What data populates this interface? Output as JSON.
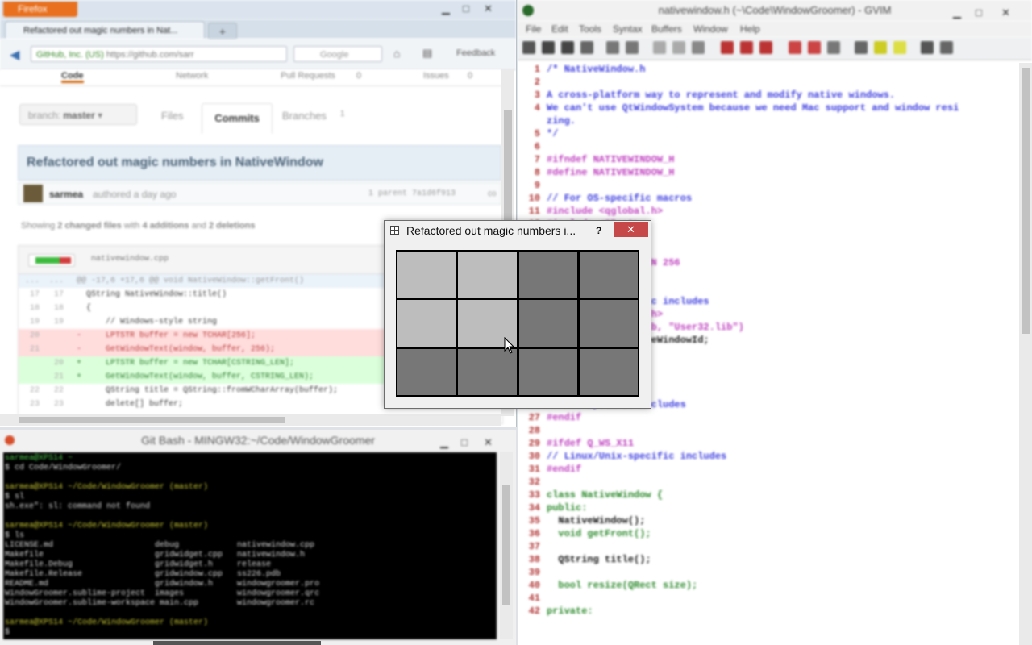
{
  "firefox": {
    "menu_button": "Firefox",
    "tab_title": "Refactored out magic numbers in Nat...",
    "url_identity": "GitHub, Inc. (US)",
    "url": "https://github.com/sarr",
    "search_placeholder": "Google",
    "feedback_label": "Feedback",
    "gh_tabs": [
      "Code",
      "Network",
      "Pull Requests",
      "Issues"
    ],
    "gh_tab_counts": [
      "0",
      "0"
    ],
    "branch_label": "branch:",
    "branch_value": "master",
    "subtabs": [
      "Files",
      "Commits",
      "Branches"
    ],
    "branches_count": "1",
    "commit_title": "Refactored out magic numbers in NativeWindow",
    "author": "sarmea",
    "authored": "authored a day ago",
    "parent_info": "1 parent 7a1d6f913",
    "commit_id": "co",
    "stats_prefix": "Showing",
    "stats_files": "2 changed files",
    "stats_with": "with",
    "stats_add": "4 additions",
    "stats_and": "and",
    "stats_del": "2 deletions",
    "file_name": "nativewindow.cpp",
    "diff_rows": [
      {
        "l1": "...",
        "l2": "...",
        "code": "@@ -17,6 +17,6 @@ void NativeWindow::getFront()",
        "type": "hunk"
      },
      {
        "l1": "17",
        "l2": "17",
        "code": "  QString NativeWindow::title()",
        "type": "ctx"
      },
      {
        "l1": "18",
        "l2": "18",
        "code": "  {",
        "type": "ctx"
      },
      {
        "l1": "19",
        "l2": "19",
        "code": "      // Windows-style string",
        "type": "ctx"
      },
      {
        "l1": "20",
        "l2": "",
        "code": "-     LPTSTR buffer = new TCHAR[256];",
        "type": "del"
      },
      {
        "l1": "21",
        "l2": "",
        "code": "-     GetWindowText(window, buffer, 256);",
        "type": "del"
      },
      {
        "l1": "",
        "l2": "20",
        "code": "+     LPTSTR buffer = new TCHAR[CSTRING_LEN];",
        "type": "add"
      },
      {
        "l1": "",
        "l2": "21",
        "code": "+     GetWindowText(window, buffer, CSTRING_LEN);",
        "type": "add"
      },
      {
        "l1": "22",
        "l2": "22",
        "code": "      QString title = QString::fromWCharArray(buffer);",
        "type": "ctx"
      },
      {
        "l1": "23",
        "l2": "23",
        "code": "      delete[] buffer;",
        "type": "ctx"
      }
    ]
  },
  "gitbash": {
    "title": "Git Bash - MINGW32:~/Code/WindowGroomer",
    "lines": [
      {
        "t": "sarmea@XPS14 ~",
        "c": "tg"
      },
      {
        "t": "$ cd Code/WindowGroomer/",
        "c": ""
      },
      {
        "t": "",
        "c": ""
      },
      {
        "t": "sarmea@XPS14 ~/Code/WindowGroomer (master)",
        "c": "ty"
      },
      {
        "t": "$ sl",
        "c": ""
      },
      {
        "t": "sh.exe\": sl: command not found",
        "c": ""
      },
      {
        "t": "",
        "c": ""
      },
      {
        "t": "sarmea@XPS14 ~/Code/WindowGroomer (master)",
        "c": "ty"
      },
      {
        "t": "$ ls",
        "c": ""
      },
      {
        "t": "LICENSE.md                     debug            nativewindow.cpp",
        "c": ""
      },
      {
        "t": "Makefile                       gridwidget.cpp   nativewindow.h",
        "c": ""
      },
      {
        "t": "Makefile.Debug                 gridwidget.h     release",
        "c": ""
      },
      {
        "t": "Makefile.Release               gridwindow.cpp   ss226.pdb",
        "c": ""
      },
      {
        "t": "README.md                      gridwindow.h     windowgroomer.pro",
        "c": ""
      },
      {
        "t": "WindowGroomer.sublime-project  images           windowgroomer.qrc",
        "c": ""
      },
      {
        "t": "WindowGroomer.sublime-workspace main.cpp        windowgroomer.rc",
        "c": ""
      },
      {
        "t": "",
        "c": ""
      },
      {
        "t": "sarmea@XPS14 ~/Code/WindowGroomer (master)",
        "c": "ty"
      },
      {
        "t": "$ ",
        "c": ""
      }
    ]
  },
  "gvim": {
    "title": "nativewindow.h (~\\Code\\WindowGroomer) - GVIM",
    "menu": [
      "File",
      "Edit",
      "Tools",
      "Syntax",
      "Buffers",
      "Window",
      "Help"
    ],
    "lines": [
      {
        "n": "1",
        "c": "cm",
        "t": "/* NativeWindow.h"
      },
      {
        "n": "2",
        "c": "cm",
        "t": ""
      },
      {
        "n": "3",
        "c": "cm",
        "t": "A cross-platform way to represent and modify native windows."
      },
      {
        "n": "4",
        "c": "cm",
        "t": "We can't use QtWindowSystem because we need Mac support and window resi"
      },
      {
        "n": "",
        "c": "cm",
        "t": "zing."
      },
      {
        "n": "5",
        "c": "cm",
        "t": "*/"
      },
      {
        "n": "6",
        "c": "tx",
        "t": ""
      },
      {
        "n": "7",
        "c": "pp",
        "t": "#ifndef NATIVEWINDOW_H"
      },
      {
        "n": "8",
        "c": "pp",
        "t": "#define NATIVEWINDOW_H"
      },
      {
        "n": "9",
        "c": "tx",
        "t": ""
      },
      {
        "n": "10",
        "c": "cm",
        "t": "// For OS-specific macros"
      },
      {
        "n": "11",
        "c": "pp",
        "t": "#include <qglobal.h>"
      },
      {
        "n": "12",
        "c": "pp",
        "t": "#include <QRect>"
      },
      {
        "n": "13",
        "c": "tx",
        "t": ""
      },
      {
        "n": "14",
        "c": "tx",
        "t": ""
      },
      {
        "n": "15",
        "c": "pp",
        "t": "#define CSTRING_LEN 256"
      },
      {
        "n": "16",
        "c": "tx",
        "t": ""
      },
      {
        "n": "17",
        "c": "tx",
        "t": ""
      },
      {
        "n": "18",
        "c": "cm",
        "t": "// Windows-specific includes"
      },
      {
        "n": "19",
        "c": "pp",
        "t": "#include <windows.h>"
      },
      {
        "n": "20",
        "c": "pp",
        "t": "#pragma comment(lib, \"User32.lib\")"
      },
      {
        "n": "21",
        "c": "tx",
        "t": "typedef HWND NativeWindowId;"
      },
      {
        "n": "22",
        "c": "tx",
        "t": ""
      },
      {
        "n": "23",
        "c": "tx",
        "t": ""
      },
      {
        "n": "24",
        "c": "tx",
        "t": ""
      },
      {
        "n": "25",
        "c": "tx",
        "t": ""
      },
      {
        "n": "26",
        "c": "cm",
        "t": "// Mac-specific includes"
      },
      {
        "n": "27",
        "c": "pp",
        "t": "#endif"
      },
      {
        "n": "28",
        "c": "tx",
        "t": ""
      },
      {
        "n": "29",
        "c": "pp",
        "t": "#ifdef Q_WS_X11"
      },
      {
        "n": "30",
        "c": "cm",
        "t": "// Linux/Unix-specific includes"
      },
      {
        "n": "31",
        "c": "pp",
        "t": "#endif"
      },
      {
        "n": "32",
        "c": "tx",
        "t": ""
      },
      {
        "n": "33",
        "c": "kw",
        "t": "class NativeWindow {"
      },
      {
        "n": "34",
        "c": "kw",
        "t": "public:"
      },
      {
        "n": "35",
        "c": "tx",
        "t": "  NativeWindow();"
      },
      {
        "n": "36",
        "c": "kw",
        "t": "  void getFront();"
      },
      {
        "n": "37",
        "c": "tx",
        "t": ""
      },
      {
        "n": "38",
        "c": "tx",
        "t": "  QString title();"
      },
      {
        "n": "39",
        "c": "tx",
        "t": ""
      },
      {
        "n": "40",
        "c": "kw",
        "t": "  bool resize(QRect size);"
      },
      {
        "n": "41",
        "c": "tx",
        "t": ""
      },
      {
        "n": "42",
        "c": "kw",
        "t": "private:"
      }
    ]
  },
  "dialog": {
    "title": "Refactored out magic numbers i...",
    "help": "?",
    "close": "✕",
    "cells": [
      "light",
      "light",
      "dark",
      "dark",
      "light",
      "light",
      "dark",
      "dark",
      "dark",
      "dark",
      "dark",
      "dark"
    ]
  }
}
